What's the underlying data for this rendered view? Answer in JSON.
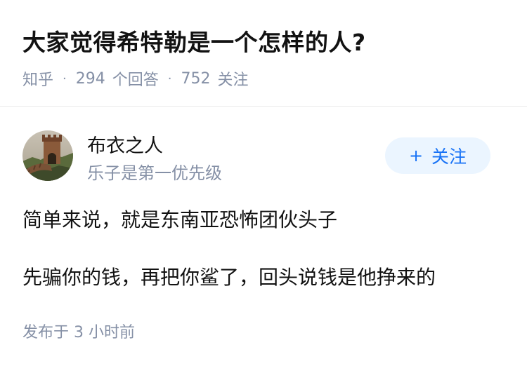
{
  "question": {
    "title": "大家觉得希特勒是一个怎样的人?",
    "source": "知乎",
    "answer_count": "294",
    "answer_label": "个回答",
    "follow_count": "752",
    "follow_label": "关注"
  },
  "author": {
    "name": "布衣之人",
    "bio": "乐子是第一优先级",
    "avatar_icon": "great-wall-avatar"
  },
  "follow_button": {
    "icon": "plus-icon",
    "plus": "+",
    "label": "关注"
  },
  "answer": {
    "lines": [
      "简单来说，就是东南亚恐怖团伙头子",
      "先骗你的钱，再把你鲨了，回头说钱是他挣来的"
    ]
  },
  "published": "发布于 3 小时前",
  "colors": {
    "accent": "#1772f6",
    "button_bg": "#ebf5ff",
    "meta_gray": "#8590a6",
    "text": "#121212"
  }
}
